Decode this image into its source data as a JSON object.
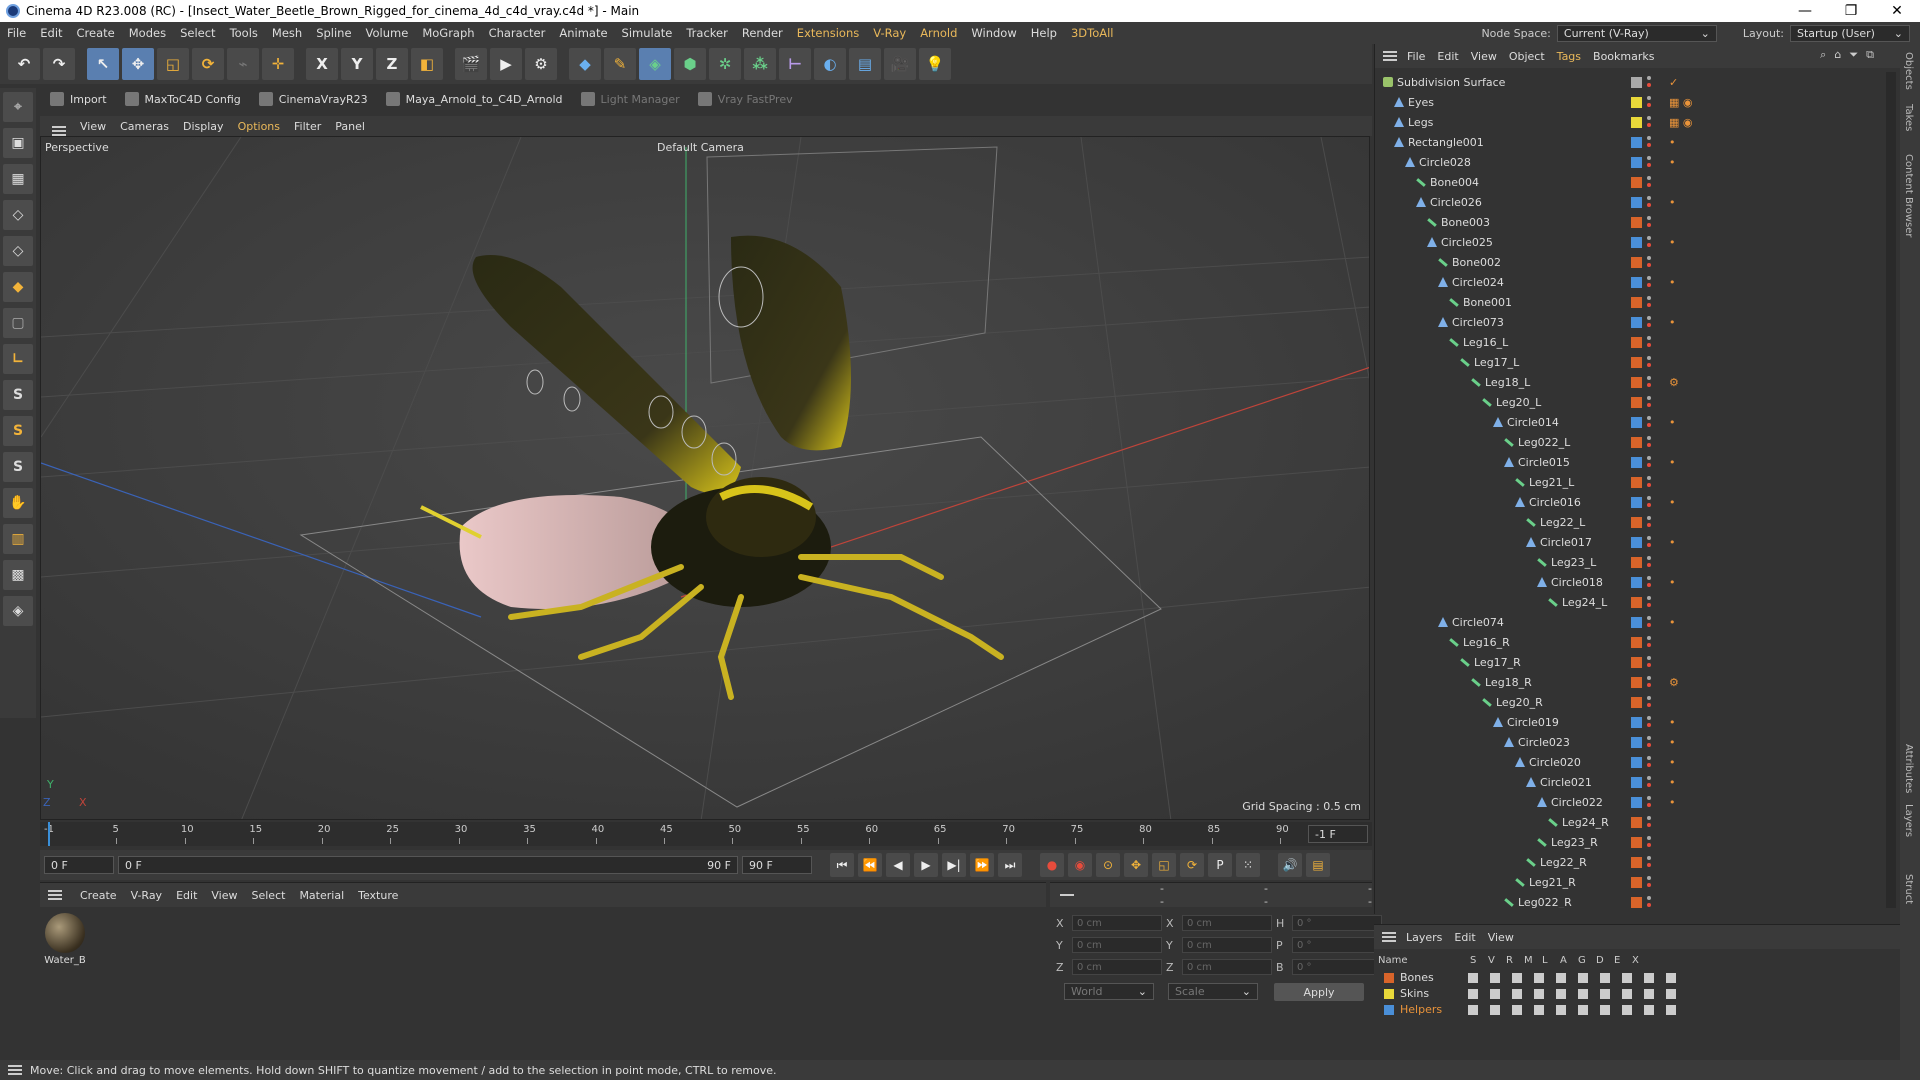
{
  "titlebar": {
    "title": "Cinema 4D R23.008 (RC) - [Insect_Water_Beetle_Brown_Rigged_for_cinema_4d_c4d_vray.c4d *] - Main",
    "min": "—",
    "max": "❐",
    "close": "✕"
  },
  "menubar": {
    "items": [
      "File",
      "Edit",
      "Create",
      "Modes",
      "Select",
      "Tools",
      "Mesh",
      "Spline",
      "Volume",
      "MoGraph",
      "Character",
      "Animate",
      "Simulate",
      "Tracker",
      "Render",
      "Extensions",
      "V-Ray",
      "Arnold",
      "Window",
      "Help",
      "3DToAll"
    ],
    "node_space_label": "Node Space:",
    "node_space_value": "Current (V-Ray)",
    "layout_label": "Layout:",
    "layout_value": "Startup (User)"
  },
  "pluginbar": {
    "items": [
      "Import",
      "MaxToC4D Config",
      "CinemaVrayR23",
      "Maya_Arnold_to_C4D_Arnold",
      "Light Manager",
      "Vray FastPrev"
    ]
  },
  "viewport": {
    "menu": [
      "View",
      "Cameras",
      "Display",
      "Options",
      "Filter",
      "Panel"
    ],
    "active_menu": "Options",
    "view_name": "Perspective",
    "camera_name": "Default Camera",
    "grid_spacing": "Grid Spacing : 0.5 cm"
  },
  "timeline": {
    "ticks": [
      "-1",
      "5",
      "10",
      "15",
      "20",
      "25",
      "30",
      "35",
      "40",
      "45",
      "50",
      "55",
      "60",
      "65",
      "70",
      "75",
      "80",
      "85",
      "90"
    ],
    "current_frame": "-1 F",
    "start_field": "0 F",
    "slider_start": "0 F",
    "slider_end": "90 F",
    "end_field": "90 F"
  },
  "material_panel": {
    "menu": [
      "Create",
      "V-Ray",
      "Edit",
      "View",
      "Select",
      "Material",
      "Texture"
    ],
    "material_name": "Water_B"
  },
  "coord_panel": {
    "header": [
      "--",
      "--",
      "--"
    ],
    "rows": [
      {
        "l1": "X",
        "v1": "0 cm",
        "l2": "X",
        "v2": "0 cm",
        "l3": "H",
        "v3": "0 °"
      },
      {
        "l1": "Y",
        "v1": "0 cm",
        "l2": "Y",
        "v2": "0 cm",
        "l3": "P",
        "v3": "0 °"
      },
      {
        "l1": "Z",
        "v1": "0 cm",
        "l2": "Z",
        "v2": "0 cm",
        "l3": "B",
        "v3": "0 °"
      }
    ],
    "world": "World",
    "scale": "Scale",
    "apply": "Apply"
  },
  "object_manager": {
    "menu": [
      "File",
      "Edit",
      "View",
      "Object",
      "Tags",
      "Bookmarks"
    ],
    "active_menu": "Tags",
    "objects": [
      {
        "name": "Subdivision Surface",
        "depth": 0,
        "type": "sub",
        "color": "#aaaaaa",
        "tags": "✓"
      },
      {
        "name": "Eyes",
        "depth": 1,
        "type": "null",
        "color": "#e8d83a",
        "tags": "▦ ◉"
      },
      {
        "name": "Legs",
        "depth": 1,
        "type": "null",
        "color": "#e8d83a",
        "tags": "▦ ◉"
      },
      {
        "name": "Rectangle001",
        "depth": 1,
        "type": "null",
        "color": "#4a8fd8",
        "tags": "•"
      },
      {
        "name": "Circle028",
        "depth": 2,
        "type": "null",
        "color": "#4a8fd8",
        "tags": "•"
      },
      {
        "name": "Bone004",
        "depth": 3,
        "type": "bone",
        "color": "#d8642a",
        "tags": ""
      },
      {
        "name": "Circle026",
        "depth": 3,
        "type": "null",
        "color": "#4a8fd8",
        "tags": "•"
      },
      {
        "name": "Bone003",
        "depth": 4,
        "type": "bone",
        "color": "#d8642a",
        "tags": ""
      },
      {
        "name": "Circle025",
        "depth": 4,
        "type": "null",
        "color": "#4a8fd8",
        "tags": "•"
      },
      {
        "name": "Bone002",
        "depth": 5,
        "type": "bone",
        "color": "#d8642a",
        "tags": ""
      },
      {
        "name": "Circle024",
        "depth": 5,
        "type": "null",
        "color": "#4a8fd8",
        "tags": "•"
      },
      {
        "name": "Bone001",
        "depth": 6,
        "type": "bone",
        "color": "#d8642a",
        "tags": ""
      },
      {
        "name": "Circle073",
        "depth": 5,
        "type": "null",
        "color": "#4a8fd8",
        "tags": "•"
      },
      {
        "name": "Leg16_L",
        "depth": 6,
        "type": "bone",
        "color": "#d8642a",
        "tags": ""
      },
      {
        "name": "Leg17_L",
        "depth": 7,
        "type": "bone",
        "color": "#d8642a",
        "tags": ""
      },
      {
        "name": "Leg18_L",
        "depth": 8,
        "type": "bone",
        "color": "#d8642a",
        "tags": "⚙"
      },
      {
        "name": "Leg20_L",
        "depth": 9,
        "type": "bone",
        "color": "#d8642a",
        "tags": ""
      },
      {
        "name": "Circle014",
        "depth": 10,
        "type": "null",
        "color": "#4a8fd8",
        "tags": "•"
      },
      {
        "name": "Leg022_L",
        "depth": 11,
        "type": "bone",
        "color": "#d8642a",
        "tags": ""
      },
      {
        "name": "Circle015",
        "depth": 11,
        "type": "null",
        "color": "#4a8fd8",
        "tags": "•"
      },
      {
        "name": "Leg21_L",
        "depth": 12,
        "type": "bone",
        "color": "#d8642a",
        "tags": ""
      },
      {
        "name": "Circle016",
        "depth": 12,
        "type": "null",
        "color": "#4a8fd8",
        "tags": "•"
      },
      {
        "name": "Leg22_L",
        "depth": 13,
        "type": "bone",
        "color": "#d8642a",
        "tags": ""
      },
      {
        "name": "Circle017",
        "depth": 13,
        "type": "null",
        "color": "#4a8fd8",
        "tags": "•"
      },
      {
        "name": "Leg23_L",
        "depth": 14,
        "type": "bone",
        "color": "#d8642a",
        "tags": ""
      },
      {
        "name": "Circle018",
        "depth": 14,
        "type": "null",
        "color": "#4a8fd8",
        "tags": "•"
      },
      {
        "name": "Leg24_L",
        "depth": 15,
        "type": "bone",
        "color": "#d8642a",
        "tags": ""
      },
      {
        "name": "Circle074",
        "depth": 5,
        "type": "null",
        "color": "#4a8fd8",
        "tags": "•"
      },
      {
        "name": "Leg16_R",
        "depth": 6,
        "type": "bone",
        "color": "#d8642a",
        "tags": ""
      },
      {
        "name": "Leg17_R",
        "depth": 7,
        "type": "bone",
        "color": "#d8642a",
        "tags": ""
      },
      {
        "name": "Leg18_R",
        "depth": 8,
        "type": "bone",
        "color": "#d8642a",
        "tags": "⚙"
      },
      {
        "name": "Leg20_R",
        "depth": 9,
        "type": "bone",
        "color": "#d8642a",
        "tags": ""
      },
      {
        "name": "Circle019",
        "depth": 10,
        "type": "null",
        "color": "#4a8fd8",
        "tags": "•"
      },
      {
        "name": "Circle023",
        "depth": 11,
        "type": "null",
        "color": "#4a8fd8",
        "tags": "•"
      },
      {
        "name": "Circle020",
        "depth": 12,
        "type": "null",
        "color": "#4a8fd8",
        "tags": "•"
      },
      {
        "name": "Circle021",
        "depth": 13,
        "type": "null",
        "color": "#4a8fd8",
        "tags": "•"
      },
      {
        "name": "Circle022",
        "depth": 14,
        "type": "null",
        "color": "#4a8fd8",
        "tags": "•"
      },
      {
        "name": "Leg24_R",
        "depth": 15,
        "type": "bone",
        "color": "#d8642a",
        "tags": ""
      },
      {
        "name": "Leg23_R",
        "depth": 14,
        "type": "bone",
        "color": "#d8642a",
        "tags": ""
      },
      {
        "name": "Leg22_R",
        "depth": 13,
        "type": "bone",
        "color": "#d8642a",
        "tags": ""
      },
      {
        "name": "Leg21_R",
        "depth": 12,
        "type": "bone",
        "color": "#d8642a",
        "tags": ""
      },
      {
        "name": "Leg022_R",
        "depth": 11,
        "type": "bone",
        "color": "#d8642a",
        "tags": ""
      }
    ]
  },
  "layers": {
    "menu": [
      "Layers",
      "Edit",
      "View"
    ],
    "columns": [
      "Name",
      "S",
      "V",
      "R",
      "M",
      "L",
      "A",
      "G",
      "D",
      "E",
      "X"
    ],
    "items": [
      {
        "name": "Bones",
        "color": "#d8642a",
        "selected": false
      },
      {
        "name": "Skins",
        "color": "#e8d83a",
        "selected": false
      },
      {
        "name": "Helpers",
        "color": "#4a8fd8",
        "selected": true
      }
    ]
  },
  "side_tabs": [
    "Objects",
    "Takes",
    "Content Browser",
    "Attributes",
    "Layers",
    "Struct"
  ],
  "status": "Move: Click and drag to move elements. Hold down SHIFT to quantize movement / add to the selection in point mode, CTRL to remove."
}
